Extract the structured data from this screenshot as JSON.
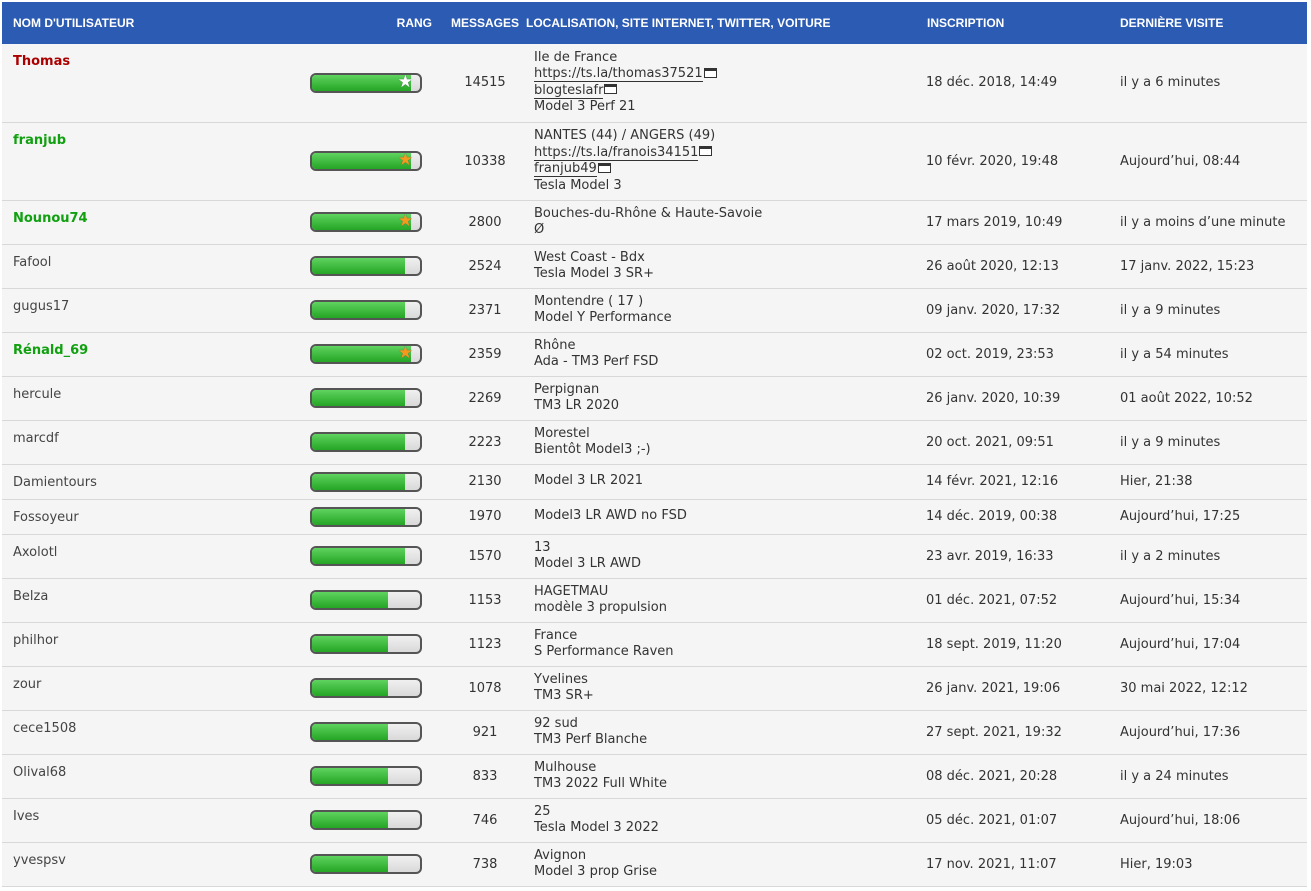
{
  "header": {
    "username": "Nom d'utilisateur",
    "rank": "Rang",
    "messages": "Messages",
    "location": "Localisation, site internet, Twitter, voiture",
    "registration": "Inscription",
    "last_visit": "Dernière visite"
  },
  "colors": {
    "header_bg": "#2c5bb3",
    "admin": "#aa0000",
    "moderator": "#10a010",
    "rank_fill": "#2fb52f"
  },
  "rows": [
    {
      "user": "Thomas",
      "role": "admin",
      "rank_fill_pct": 92,
      "star": "white",
      "messages": "14515",
      "location": "Ile de France",
      "website": "https://ts.la/thomas37521",
      "twitter": "blogteslafr",
      "car": "Model 3 Perf 21",
      "registered": "18 déc. 2018, 14:49",
      "last_visit": "il y a 6 minutes"
    },
    {
      "user": "franjub",
      "role": "mod",
      "rank_fill_pct": 92,
      "star": "orange",
      "messages": "10338",
      "location": "NANTES (44) / ANGERS (49)",
      "website": "https://ts.la/franois34151",
      "twitter": "franjub49",
      "car": "Tesla Model 3",
      "registered": "10 févr. 2020, 19:48",
      "last_visit": "Aujourd’hui, 08:44"
    },
    {
      "user": "Nounou74",
      "role": "mod",
      "rank_fill_pct": 92,
      "star": "orange",
      "messages": "2800",
      "location": "Bouches-du-Rhône & Haute-Savoie",
      "car": "Ø",
      "registered": "17 mars 2019, 10:49",
      "last_visit": "il y a moins d’une minute"
    },
    {
      "user": "Fafool",
      "role": "user",
      "rank_fill_pct": 86,
      "messages": "2524",
      "location": "West Coast - Bdx",
      "car": "Tesla Model 3 SR+",
      "registered": "26 août 2020, 12:13",
      "last_visit": "17 janv. 2022, 15:23"
    },
    {
      "user": "gugus17",
      "role": "user",
      "rank_fill_pct": 86,
      "messages": "2371",
      "location": "Montendre ( 17 )",
      "car": "Model Y Performance",
      "registered": "09 janv. 2020, 17:32",
      "last_visit": "il y a 9 minutes"
    },
    {
      "user": "Rénald_69",
      "role": "mod",
      "rank_fill_pct": 92,
      "star": "orange",
      "messages": "2359",
      "location": "Rhône",
      "car": "Ada - TM3 Perf FSD",
      "registered": "02 oct. 2019, 23:53",
      "last_visit": "il y a 54 minutes"
    },
    {
      "user": "hercule",
      "role": "user",
      "rank_fill_pct": 86,
      "messages": "2269",
      "location": "Perpignan",
      "car": "TM3 LR 2020",
      "registered": "26 janv. 2020, 10:39",
      "last_visit": "01 août 2022, 10:52"
    },
    {
      "user": "marcdf",
      "role": "user",
      "rank_fill_pct": 86,
      "messages": "2223",
      "location": "Morestel",
      "car": "Bientôt Model3 ;-)",
      "registered": "20 oct. 2021, 09:51",
      "last_visit": "il y a 9 minutes"
    },
    {
      "user": "Damientours",
      "role": "user",
      "rank_fill_pct": 86,
      "messages": "2130",
      "car": "Model 3 LR 2021",
      "registered": "14 févr. 2021, 12:16",
      "last_visit": "Hier, 21:38"
    },
    {
      "user": "Fossoyeur",
      "role": "user",
      "rank_fill_pct": 86,
      "messages": "1970",
      "car": "Model3 LR AWD no FSD",
      "registered": "14 déc. 2019, 00:38",
      "last_visit": "Aujourd’hui, 17:25"
    },
    {
      "user": "Axolotl",
      "role": "user",
      "rank_fill_pct": 86,
      "messages": "1570",
      "location": "13",
      "car": "Model 3 LR AWD",
      "registered": "23 avr. 2019, 16:33",
      "last_visit": "il y a 2 minutes"
    },
    {
      "user": "Belza",
      "role": "user",
      "rank_fill_pct": 70,
      "messages": "1153",
      "location": "HAGETMAU",
      "car": "modèle 3 propulsion",
      "registered": "01 déc. 2021, 07:52",
      "last_visit": "Aujourd’hui, 15:34"
    },
    {
      "user": "philhor",
      "role": "user",
      "rank_fill_pct": 70,
      "messages": "1123",
      "location": "France",
      "car": "S Performance Raven",
      "registered": "18 sept. 2019, 11:20",
      "last_visit": "Aujourd’hui, 17:04"
    },
    {
      "user": "zour",
      "role": "user",
      "rank_fill_pct": 70,
      "messages": "1078",
      "location": "Yvelines",
      "car": "TM3 SR+",
      "registered": "26 janv. 2021, 19:06",
      "last_visit": "30 mai 2022, 12:12"
    },
    {
      "user": "cece1508",
      "role": "user",
      "rank_fill_pct": 70,
      "messages": "921",
      "location": "92 sud",
      "car": "TM3 Perf Blanche",
      "registered": "27 sept. 2021, 19:32",
      "last_visit": "Aujourd’hui, 17:36"
    },
    {
      "user": "Olival68",
      "role": "user",
      "rank_fill_pct": 70,
      "messages": "833",
      "location": "Mulhouse",
      "car": "TM3 2022 Full White",
      "registered": "08 déc. 2021, 20:28",
      "last_visit": "il y a 24 minutes"
    },
    {
      "user": "Ives",
      "role": "user",
      "rank_fill_pct": 70,
      "messages": "746",
      "location": "25",
      "car": "Tesla Model 3 2022",
      "registered": "05 déc. 2021, 01:07",
      "last_visit": "Aujourd’hui, 18:06"
    },
    {
      "user": "yvespsv",
      "role": "user",
      "rank_fill_pct": 70,
      "messages": "738",
      "location": "Avignon",
      "car": "Model 3 prop Grise",
      "registered": "17 nov. 2021, 11:07",
      "last_visit": "Hier, 19:03"
    }
  ]
}
